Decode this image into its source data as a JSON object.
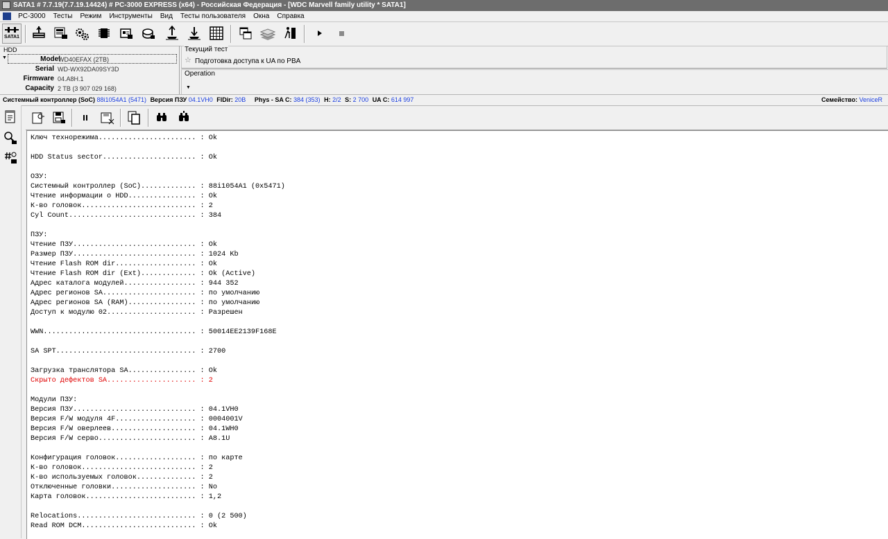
{
  "window": {
    "title": "SATA1 # 7.7.19(7.7.19.14424) # PC-3000 EXPRESS (x64) - Российская Федерация - [WDC Marvell family utility * SATA1]"
  },
  "menu": {
    "items": [
      "PC-3000",
      "Тесты",
      "Режим",
      "Инструменты",
      "Вид",
      "Тесты пользователя",
      "Окна",
      "Справка"
    ]
  },
  "toolbar": {
    "port_label": "SATA1"
  },
  "hdd": {
    "legend": "HDD",
    "fields": [
      {
        "label": "Model",
        "value": "WD40EFAX (2TB)"
      },
      {
        "label": "Serial",
        "value": "WD-WX92DA09SY3D"
      },
      {
        "label": "Firmware",
        "value": "04.A8H.1"
      },
      {
        "label": "Capacity",
        "value": "2 TB (3 907 029 168)"
      }
    ]
  },
  "test_panel": {
    "current_test_label": "Текущий тест",
    "current_test": "Подготовка доступа к UA по PBA",
    "operation_label": "Operation"
  },
  "status": {
    "soc_label": "Системный контроллер (SoC)",
    "soc_value": "88i1054A1 (5471)",
    "rom_label": "Версия ПЗУ",
    "rom_value": "04.1VH0",
    "fldir_label": "FlDir:",
    "fldir_value": "20B",
    "phys_label": "Phys - SA C:",
    "phys_value": "384 (353)",
    "h_label": "H:",
    "h_value": "2/2",
    "s_label": "S:",
    "s_value": "2 700",
    "ua_label": "UA C:",
    "ua_value": "614 997",
    "family_label": "Семейство:",
    "family_value": "VeniceR"
  },
  "log": {
    "lines": [
      {
        "text": "Ключ технорежима....................... : Ok",
        "error": false
      },
      {
        "text": "",
        "error": false
      },
      {
        "text": "HDD Status sector...................... : Ok",
        "error": false
      },
      {
        "text": "",
        "error": false
      },
      {
        "text": "ОЗУ:",
        "error": false
      },
      {
        "text": "Системный контроллер (SoC)............. : 88i1054A1 (0x5471)",
        "error": false
      },
      {
        "text": "Чтение информации о HDD................ : Ok",
        "error": false
      },
      {
        "text": "К-во головок........................... : 2",
        "error": false
      },
      {
        "text": "Cyl Count.............................. : 384",
        "error": false
      },
      {
        "text": "",
        "error": false
      },
      {
        "text": "ПЗУ:",
        "error": false
      },
      {
        "text": "Чтение ПЗУ............................. : Ok",
        "error": false
      },
      {
        "text": "Размер ПЗУ............................. : 1024 Kb",
        "error": false
      },
      {
        "text": "Чтение Flash ROM dir................... : Ok",
        "error": false
      },
      {
        "text": "Чтение Flash ROM dir (Ext)............. : Ok (Active)",
        "error": false
      },
      {
        "text": "Адрес каталога модулей................. : 944 352",
        "error": false
      },
      {
        "text": "Адрес регионов SA...................... : по умолчанию",
        "error": false
      },
      {
        "text": "Адрес регионов SA (RAM)................ : по умолчанию",
        "error": false
      },
      {
        "text": "Доступ к модулю 02..................... : Разрешен",
        "error": false
      },
      {
        "text": "",
        "error": false
      },
      {
        "text": "WWN.................................... : 50014EE2139F168E",
        "error": false
      },
      {
        "text": "",
        "error": false
      },
      {
        "text": "SA SPT................................. : 2700",
        "error": false
      },
      {
        "text": "",
        "error": false
      },
      {
        "text": "Загрузка транслятора SA................ : Ok",
        "error": false
      },
      {
        "text": "Скрыто дефектов SA..................... : 2",
        "error": true
      },
      {
        "text": "",
        "error": false
      },
      {
        "text": "Модули ПЗУ:",
        "error": false
      },
      {
        "text": "Версия ПЗУ............................. : 04.1VH0",
        "error": false
      },
      {
        "text": "Версия F/W модуля 4F................... : 0004001V",
        "error": false
      },
      {
        "text": "Версия F/W оверлеев.................... : 04.1WH0",
        "error": false
      },
      {
        "text": "Версия F/W серво....................... : A8.1U",
        "error": false
      },
      {
        "text": "",
        "error": false
      },
      {
        "text": "Конфигурация головок................... : по карте",
        "error": false
      },
      {
        "text": "К-во головок........................... : 2",
        "error": false
      },
      {
        "text": "К-во используемых головок.............. : 2",
        "error": false
      },
      {
        "text": "Отключенные головки.................... : No",
        "error": false
      },
      {
        "text": "Карта головок.......................... : 1,2",
        "error": false
      },
      {
        "text": "",
        "error": false
      },
      {
        "text": "Relocations............................ : 0 (2 500)",
        "error": false
      },
      {
        "text": "Read ROM DCM........................... : Ok",
        "error": false
      }
    ]
  }
}
